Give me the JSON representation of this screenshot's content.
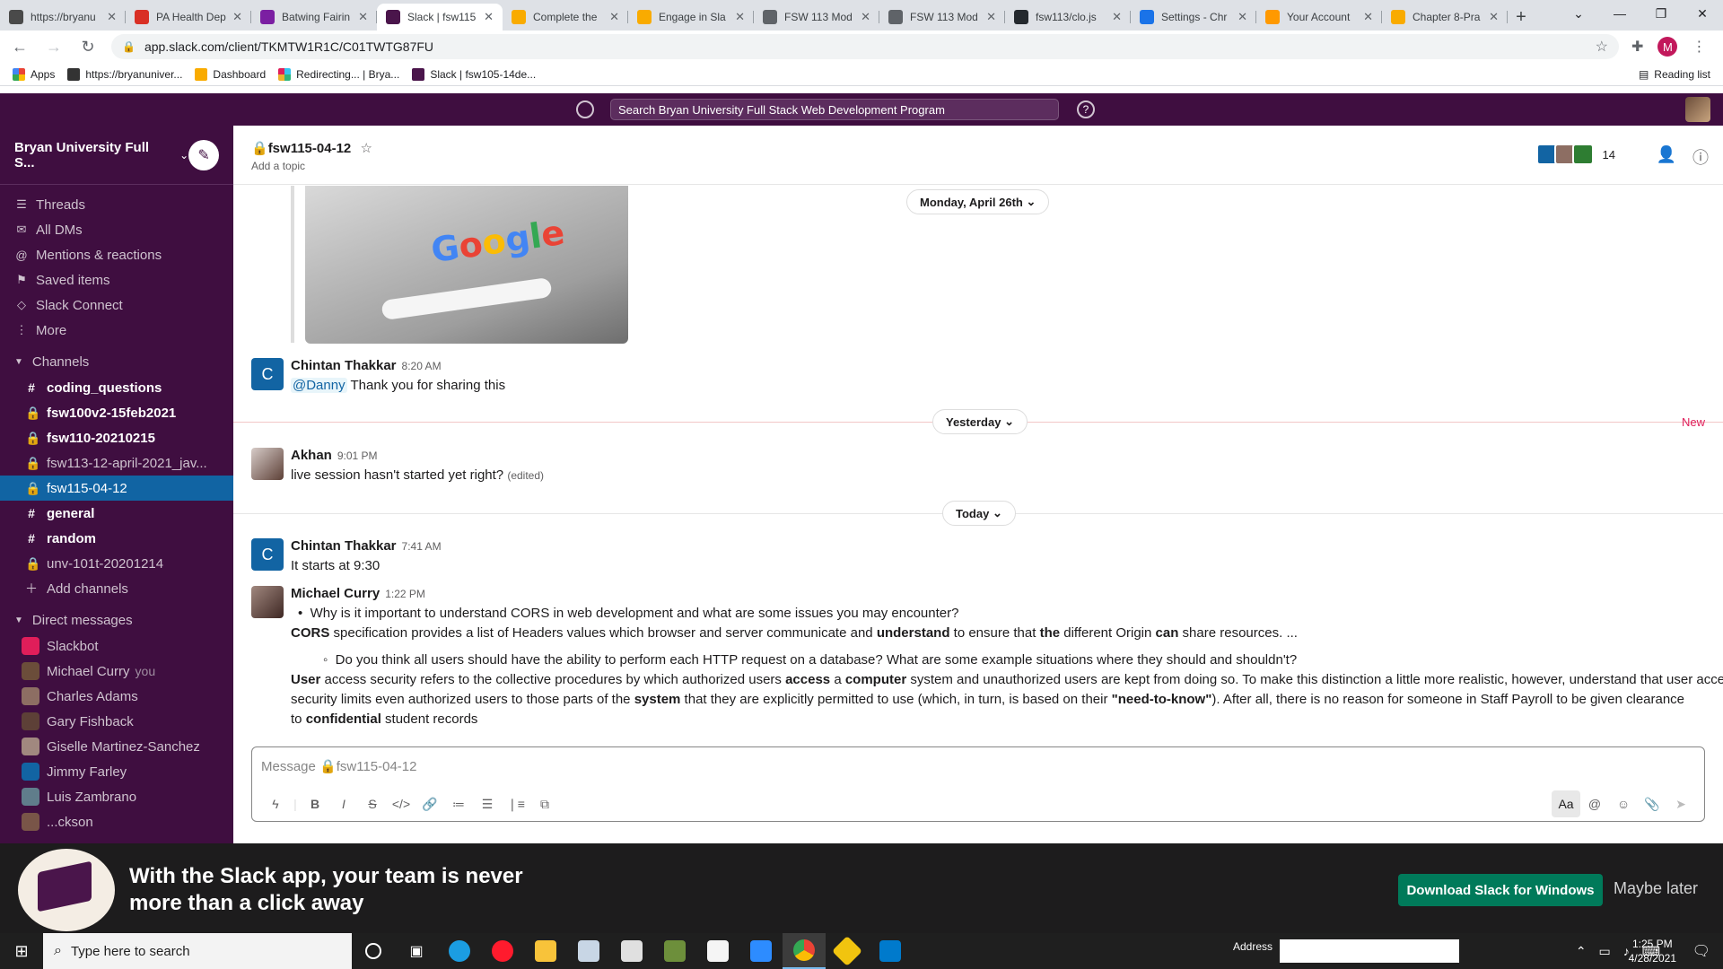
{
  "browser": {
    "tabs": [
      {
        "title": "https://bryanu",
        "color": "#4a4a4a"
      },
      {
        "title": "PA Health Dep",
        "color": "#d93025"
      },
      {
        "title": "Batwing Fairin",
        "color": "#7b1fa2"
      },
      {
        "title": "Slack | fsw115",
        "color": "#4a154b",
        "active": true
      },
      {
        "title": "Complete the",
        "color": "#f9ab00"
      },
      {
        "title": "Engage in Sla",
        "color": "#f9ab00"
      },
      {
        "title": "FSW 113 Mod",
        "color": "#5f6368"
      },
      {
        "title": "FSW 113 Mod",
        "color": "#5f6368"
      },
      {
        "title": "fsw113/clo.js",
        "color": "#24292e"
      },
      {
        "title": "Settings - Chr",
        "color": "#1a73e8"
      },
      {
        "title": "Your Account",
        "color": "#ff9900"
      },
      {
        "title": "Chapter 8-Pra",
        "color": "#f9ab00"
      }
    ],
    "url": "app.slack.com/client/TKMTW1R1C/C01TWTG87FU",
    "profile_initial": "M",
    "bookmarks": [
      {
        "label": "Apps"
      },
      {
        "label": "https://bryanuniver..."
      },
      {
        "label": "Dashboard"
      },
      {
        "label": "Redirecting... | Brya..."
      },
      {
        "label": "Slack | fsw105-14de..."
      }
    ],
    "reading_list": "Reading list"
  },
  "slack": {
    "search_placeholder": "Search Bryan University Full Stack Web Development Program",
    "workspace": "Bryan University Full S...",
    "nav": [
      {
        "label": "Threads",
        "icon": "threads-icon",
        "glyph": "☰"
      },
      {
        "label": "All DMs",
        "icon": "dm-icon",
        "glyph": "✉"
      },
      {
        "label": "Mentions & reactions",
        "icon": "at-icon",
        "glyph": "@"
      },
      {
        "label": "Saved items",
        "icon": "bookmark-icon",
        "glyph": "⚑"
      },
      {
        "label": "Slack Connect",
        "icon": "connect-icon",
        "glyph": "◇"
      },
      {
        "label": "More",
        "icon": "more-icon",
        "glyph": "⋮"
      }
    ],
    "channels_header": "Channels",
    "channels": [
      {
        "name": "coding_questions",
        "bold": true,
        "private": false
      },
      {
        "name": "fsw100v2-15feb2021",
        "bold": true,
        "private": true
      },
      {
        "name": "fsw110-20210215",
        "bold": true,
        "private": true
      },
      {
        "name": "fsw113-12-april-2021_jav...",
        "bold": false,
        "private": true
      },
      {
        "name": "fsw115-04-12",
        "bold": false,
        "private": true,
        "active": true
      },
      {
        "name": "general",
        "bold": true,
        "private": false
      },
      {
        "name": "random",
        "bold": true,
        "private": false
      },
      {
        "name": "unv-101t-20201214",
        "bold": false,
        "private": true
      }
    ],
    "add_channels": "Add channels",
    "dm_header": "Direct messages",
    "dms": [
      {
        "name": "Slackbot",
        "color": "#e01e5a"
      },
      {
        "name": "Michael Curry",
        "you": "you",
        "color": "#6b4d3a"
      },
      {
        "name": "Charles Adams",
        "color": "#8d6e63"
      },
      {
        "name": "Gary Fishback",
        "color": "#5d4037"
      },
      {
        "name": "Giselle Martinez-Sanchez",
        "color": "#a1887f"
      },
      {
        "name": "Jimmy Farley",
        "color": "#1264a3"
      },
      {
        "name": "Luis Zambrano",
        "color": "#607d8b"
      },
      {
        "name": "...ckson",
        "color": "#795548"
      }
    ],
    "channel": {
      "name": "fsw115-04-12",
      "topic": "Add a topic",
      "member_count": "14"
    },
    "days": {
      "monday": "Monday, April 26th",
      "yesterday": "Yesterday",
      "today": "Today",
      "new_label": "New"
    },
    "messages": {
      "m1": {
        "author": "Chintan Thakkar",
        "time": "8:20 AM",
        "mention": "@Danny",
        "text": "Thank you for sharing this",
        "initial": "C"
      },
      "m2": {
        "author": "Akhan",
        "time": "9:01 PM",
        "text": "live session hasn't  started yet right?",
        "edited": "(edited)"
      },
      "m3": {
        "author": "Chintan Thakkar",
        "time": "7:41 AM",
        "text": "It starts at 9:30",
        "initial": "C"
      },
      "m4": {
        "author": "Michael Curry",
        "time": "1:22 PM",
        "q1": "Why is it important to understand CORS in web development and what are some issues you may encounter?",
        "a1_b1": "CORS",
        "a1_t1": " specification provides a list of Headers values which browser and server communicate and ",
        "a1_b2": "understand",
        "a1_t2": " to ensure that ",
        "a1_b3": "the",
        "a1_t3": " different Origin ",
        "a1_b4": "can",
        "a1_t4": " share resources. ...",
        "q2": "Do you think all users should have the ability to perform each HTTP request on a database? What are some example situations where they should and shouldn't?",
        "a2_b1": "User",
        "a2_t1": " access security refers to the collective procedures by which authorized users ",
        "a2_b2": "access",
        "a2_t2": " a ",
        "a2_b3": "computer",
        "a2_t3": " system and unauthorized users are kept from doing so. To make this distinction a little more realistic, however, understand that user access",
        "a2_t4": "security limits even authorized users to those parts of the ",
        "a2_b4": "system",
        "a2_t5": " that they are explicitly permitted to use (which, in turn, is based on their ",
        "a2_b5": "\"need-to-know\"",
        "a2_t6": "). After all, there is no reason for someone in Staff Payroll to be given clearance",
        "a2_t7": "to ",
        "a2_b6": "confidential",
        "a2_t8": " student records"
      }
    },
    "composer_placeholder": "Message 🔒fsw115-04-12",
    "banner": {
      "line1": "With the Slack app, your team is never",
      "line2": "more than a click away",
      "download": "Download Slack for Windows",
      "later": "Maybe later"
    }
  },
  "taskbar": {
    "search_placeholder": "Type here to search",
    "address_label": "Address",
    "time": "1:25 PM",
    "date": "4/28/2021"
  }
}
